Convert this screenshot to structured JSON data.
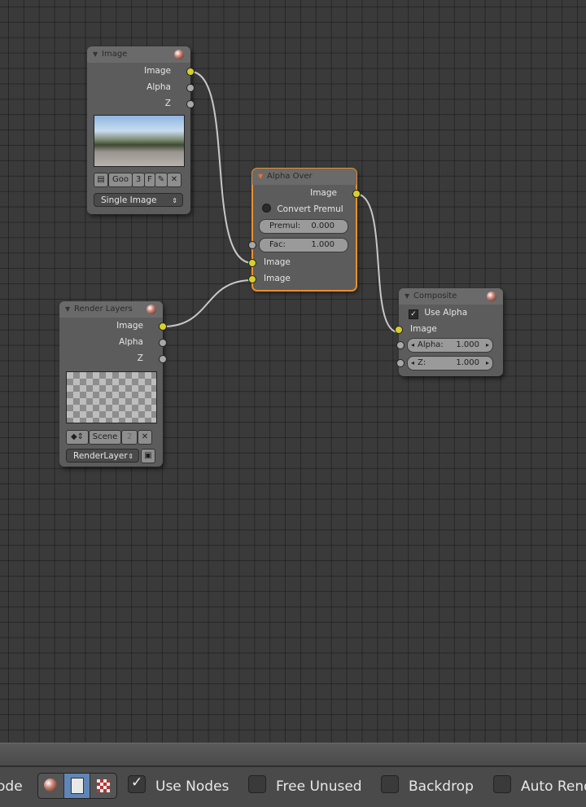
{
  "colors": {
    "accent_selected": "#e8902e",
    "socket_image": "#d8d028",
    "socket_value": "#a8a8a8",
    "link": "#c8c8c8"
  },
  "nodes": {
    "image": {
      "title": "Image",
      "outputs": [
        "Image",
        "Alpha",
        "Z"
      ],
      "file_name": "Goo",
      "users": "3",
      "fake_label": "F",
      "source": "Single Image"
    },
    "alpha_over": {
      "title": "Alpha Over",
      "outputs": [
        "Image"
      ],
      "convert_premul": "Convert Premul",
      "premul_label": "Premul:",
      "premul_value": "0.000",
      "fac_label": "Fac:",
      "fac_value": "1.000",
      "inputs": [
        "Image",
        "Image"
      ]
    },
    "render_layers": {
      "title": "Render Layers",
      "outputs": [
        "Image",
        "Alpha",
        "Z"
      ],
      "scene": "Scene",
      "scene_users": "2",
      "layer": "RenderLayer"
    },
    "composite": {
      "title": "Composite",
      "use_alpha": "Use Alpha",
      "inputs": [
        "Image"
      ],
      "alpha_label": "Alpha:",
      "alpha_value": "1.000",
      "z_label": "Z:",
      "z_value": "1.000"
    }
  },
  "toolbar": {
    "mode_label": "ode",
    "use_nodes": "Use Nodes",
    "free_unused": "Free Unused",
    "backdrop": "Backdrop",
    "auto_render": "Auto Rend",
    "use_nodes_checked": true
  }
}
